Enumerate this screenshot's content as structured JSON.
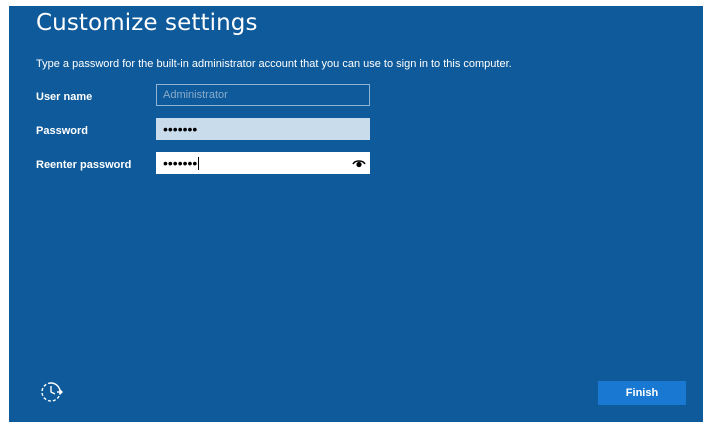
{
  "page": {
    "title": "Customize settings",
    "subtitle": "Type a password for the built-in administrator account that you can use to sign in to this computer."
  },
  "fields": {
    "username": {
      "label": "User name",
      "placeholder": "Administrator",
      "value": ""
    },
    "password": {
      "label": "Password",
      "masked_value": "•••••••"
    },
    "reenter": {
      "label": "Reenter password",
      "masked_value": "•••••••"
    }
  },
  "icons": {
    "reveal": "eye-icon",
    "accessibility": "ease-of-access-icon"
  },
  "buttons": {
    "finish_label": "Finish"
  },
  "colors": {
    "background": "#0e5a9a",
    "accent_button": "#1979d2",
    "password_field": "#c9dcec"
  }
}
